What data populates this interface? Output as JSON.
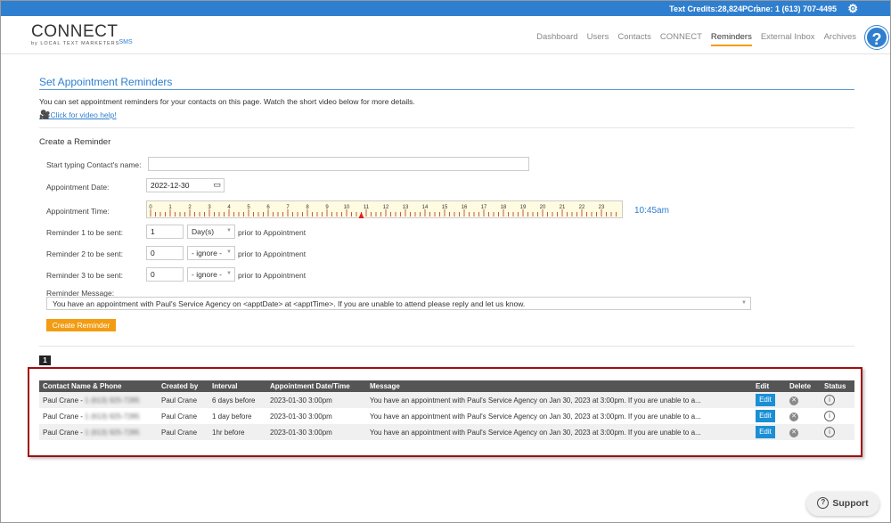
{
  "topbar": {
    "credits": "Text Credits:28,824",
    "separator": "|",
    "phone": "PCrane: 1 (613) 707-4495",
    "gear_icon": "gear-icon"
  },
  "logo": {
    "brand": "CONNECT",
    "sms": "SMS",
    "sub": "by LOCAL TEXT MARKETERS"
  },
  "nav": {
    "items": [
      "Dashboard",
      "Users",
      "Contacts",
      "CONNECT",
      "Reminders",
      "External Inbox",
      "Archives"
    ],
    "active": "Reminders"
  },
  "help": {
    "label": "?"
  },
  "page": {
    "title": "Set Appointment Reminders",
    "intro": "You can set appointment reminders for your contacts on this page. Watch the short video below for more details.",
    "video_link": "Click for video help!",
    "create_title": "Create a Reminder"
  },
  "form": {
    "contact_label": "Start typing Contact's name:",
    "contact_value": "",
    "date_label": "Appointment Date:",
    "date_value": "2022-12-30",
    "time_label": "Appointment Time:",
    "time_value": "10:45am",
    "ruler_hours": [
      "0",
      "1",
      "2",
      "3",
      "4",
      "5",
      "6",
      "7",
      "8",
      "9",
      "10",
      "11",
      "12",
      "13",
      "14",
      "15",
      "16",
      "17",
      "18",
      "19",
      "20",
      "21",
      "22",
      "23"
    ],
    "reminders": [
      {
        "label": "Reminder 1 to be sent:",
        "value": "1",
        "unit": "Day(s)",
        "suffix": "prior to Appointment"
      },
      {
        "label": "Reminder 2 to be sent:",
        "value": "0",
        "unit": "- ignore -",
        "suffix": "prior to Appointment"
      },
      {
        "label": "Reminder 3 to be sent:",
        "value": "0",
        "unit": "- ignore -",
        "suffix": "prior to Appointment"
      }
    ],
    "message_label": "Reminder Message:",
    "message_value": "You have an appointment with Paul's Service Agency on <apptDate> at <apptTime>. If you are unable to attend please reply and let us know.",
    "create_button": "Create Reminder"
  },
  "pagination": {
    "current": "1"
  },
  "table": {
    "headers": [
      "Contact Name & Phone",
      "Created by",
      "Interval",
      "Appointment Date/Time",
      "Message",
      "Edit",
      "Delete",
      "Status"
    ],
    "rows": [
      {
        "name": "Paul Crane -",
        "phone": "1 (613) 925-7285",
        "created_by": "Paul Crane",
        "interval": "6 days before",
        "appt": "2023-01-30 3:00pm",
        "message": "You have an appointment with Paul's Service Agency on Jan 30, 2023 at 3:00pm. If you are unable to a...",
        "edit": "Edit"
      },
      {
        "name": "Paul Crane -",
        "phone": "1 (613) 925-7285",
        "created_by": "Paul Crane",
        "interval": "1 day before",
        "appt": "2023-01-30 3:00pm",
        "message": "You have an appointment with Paul's Service Agency on Jan 30, 2023 at 3:00pm. If you are unable to a...",
        "edit": "Edit"
      },
      {
        "name": "Paul Crane -",
        "phone": "1 (613) 925-7285",
        "created_by": "Paul Crane",
        "interval": "1hr before",
        "appt": "2023-01-30 3:00pm",
        "message": "You have an appointment with Paul's Service Agency on Jan 30, 2023 at 3:00pm. If you are unable to a...",
        "edit": "Edit"
      }
    ]
  },
  "support": {
    "label": "Support"
  },
  "colors": {
    "accent": "#2f7fd0",
    "button": "#f39c12",
    "highlight_border": "#a01010",
    "edit_button": "#1b8fd6"
  }
}
